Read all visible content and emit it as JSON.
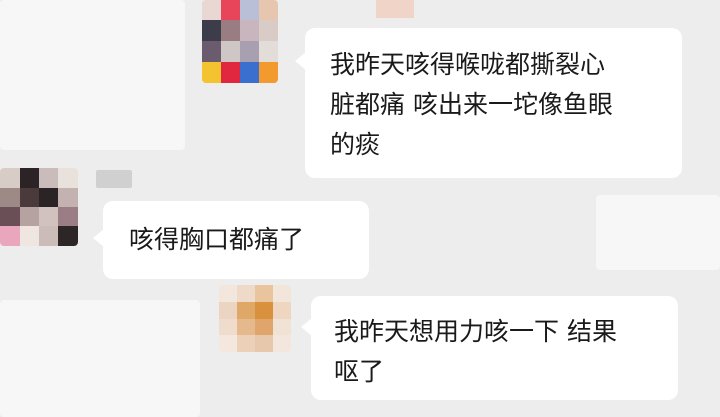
{
  "conversation": {
    "messages": [
      {
        "lines": [
          "我昨天咳得喉咙都撕裂心",
          "脏都痛 咳出来一坨像鱼眼",
          "的痰"
        ]
      },
      {
        "lines": [
          "咳得胸口都痛了"
        ]
      },
      {
        "lines": [
          "我昨天想用力咳一下 结果",
          "呕了"
        ]
      }
    ]
  },
  "colors": {
    "background": "#ededed",
    "bubble": "#ffffff",
    "text": "#1a1a1a"
  }
}
